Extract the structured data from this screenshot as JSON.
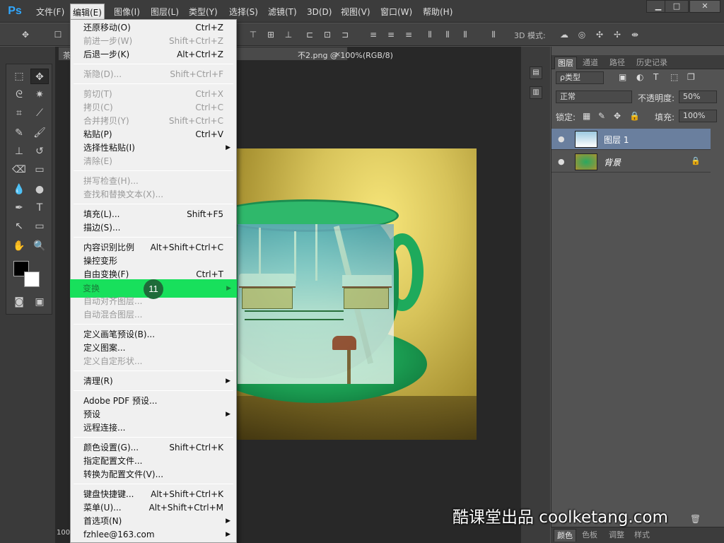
{
  "app": {
    "logo": "Ps"
  },
  "menubar": {
    "items": [
      "文件(F)",
      "编辑(E)",
      "图像(I)",
      "图层(L)",
      "类型(Y)",
      "选择(S)",
      "滤镜(T)",
      "3D(D)",
      "视图(V)",
      "窗口(W)",
      "帮助(H)"
    ],
    "active": "编辑(E)"
  },
  "window_controls": {
    "minimize": "▁",
    "maximize": "□",
    "close": "✕"
  },
  "options_bar": {
    "mode_3d": "3D 模式:"
  },
  "document": {
    "tab_title": "不2.png @ 100%(RGB/8)",
    "tab_prefix": "茶",
    "close_symbol": "×",
    "zoom": "100"
  },
  "edit_menu": {
    "items": [
      {
        "label": "还原移动(O)",
        "shortcut": "Ctrl+Z",
        "disabled": false
      },
      {
        "label": "前进一步(W)",
        "shortcut": "Shift+Ctrl+Z",
        "disabled": true
      },
      {
        "label": "后退一步(K)",
        "shortcut": "Alt+Ctrl+Z",
        "disabled": false
      },
      {
        "label": "渐隐(D)...",
        "shortcut": "Shift+Ctrl+F",
        "disabled": true
      },
      {
        "label": "剪切(T)",
        "shortcut": "Ctrl+X",
        "disabled": true
      },
      {
        "label": "拷贝(C)",
        "shortcut": "Ctrl+C",
        "disabled": true
      },
      {
        "label": "合并拷贝(Y)",
        "shortcut": "Shift+Ctrl+C",
        "disabled": true
      },
      {
        "label": "粘贴(P)",
        "shortcut": "Ctrl+V",
        "disabled": false
      },
      {
        "label": "选择性粘贴(I)",
        "shortcut": "",
        "submenu": true,
        "disabled": false
      },
      {
        "label": "清除(E)",
        "shortcut": "",
        "disabled": true
      },
      {
        "label": "拼写检查(H)...",
        "shortcut": "",
        "disabled": true
      },
      {
        "label": "查找和替换文本(X)...",
        "shortcut": "",
        "disabled": true
      },
      {
        "label": "填充(L)...",
        "shortcut": "Shift+F5",
        "disabled": false
      },
      {
        "label": "描边(S)...",
        "shortcut": "",
        "disabled": false
      },
      {
        "label": "内容识别比例",
        "shortcut": "Alt+Shift+Ctrl+C",
        "disabled": false
      },
      {
        "label": "操控变形",
        "shortcut": "",
        "disabled": false
      },
      {
        "label": "自由变换(F)",
        "shortcut": "Ctrl+T",
        "disabled": false
      },
      {
        "label": "变换",
        "shortcut": "",
        "submenu": true,
        "highlighted": true
      },
      {
        "label": "自动对齐图层...",
        "shortcut": "",
        "disabled": true
      },
      {
        "label": "自动混合图层...",
        "shortcut": "",
        "disabled": true
      },
      {
        "label": "定义画笔预设(B)...",
        "shortcut": "",
        "disabled": false
      },
      {
        "label": "定义图案...",
        "shortcut": "",
        "disabled": false
      },
      {
        "label": "定义自定形状...",
        "shortcut": "",
        "disabled": true
      },
      {
        "label": "清理(R)",
        "shortcut": "",
        "submenu": true,
        "disabled": false
      },
      {
        "label": "Adobe PDF 预设...",
        "shortcut": "",
        "disabled": false
      },
      {
        "label": "预设",
        "shortcut": "",
        "submenu": true,
        "disabled": false
      },
      {
        "label": "远程连接...",
        "shortcut": "",
        "disabled": false
      },
      {
        "label": "颜色设置(G)...",
        "shortcut": "Shift+Ctrl+K",
        "disabled": false
      },
      {
        "label": "指定配置文件...",
        "shortcut": "",
        "disabled": false
      },
      {
        "label": "转换为配置文件(V)...",
        "shortcut": "",
        "disabled": false
      },
      {
        "label": "键盘快捷键...",
        "shortcut": "Alt+Shift+Ctrl+K",
        "disabled": false
      },
      {
        "label": "菜单(U)...",
        "shortcut": "Alt+Shift+Ctrl+M",
        "disabled": false
      },
      {
        "label": "首选项(N)",
        "shortcut": "",
        "submenu": true,
        "disabled": false
      },
      {
        "label": "fzhlee@163.com",
        "shortcut": "",
        "submenu": true,
        "disabled": false
      }
    ],
    "step_badge": "11",
    "submenu_arrow": "▶"
  },
  "layers_panel": {
    "tabs": [
      "图层",
      "通道",
      "路径",
      "历史记录"
    ],
    "active_tab": "图层",
    "filter_label": "ρ类型",
    "blend_mode": "正常",
    "opacity_label": "不透明度:",
    "opacity_value": "50%",
    "lock_label": "锁定:",
    "fill_label": "填充:",
    "fill_value": "100%",
    "layers": [
      {
        "name": "图层 1",
        "selected": true
      },
      {
        "name": "背景",
        "selected": false,
        "locked": true
      }
    ],
    "eye_symbol": "●",
    "lock_symbol": "🔒"
  },
  "bottom_tabs": [
    "颜色",
    "色板",
    "调整",
    "样式"
  ],
  "watermark": "酷课堂出品 coolketang.com",
  "colors": {
    "highlight": "#18e05c",
    "badge": "#1f6b3a",
    "selected_layer": "#6a7f9e"
  }
}
